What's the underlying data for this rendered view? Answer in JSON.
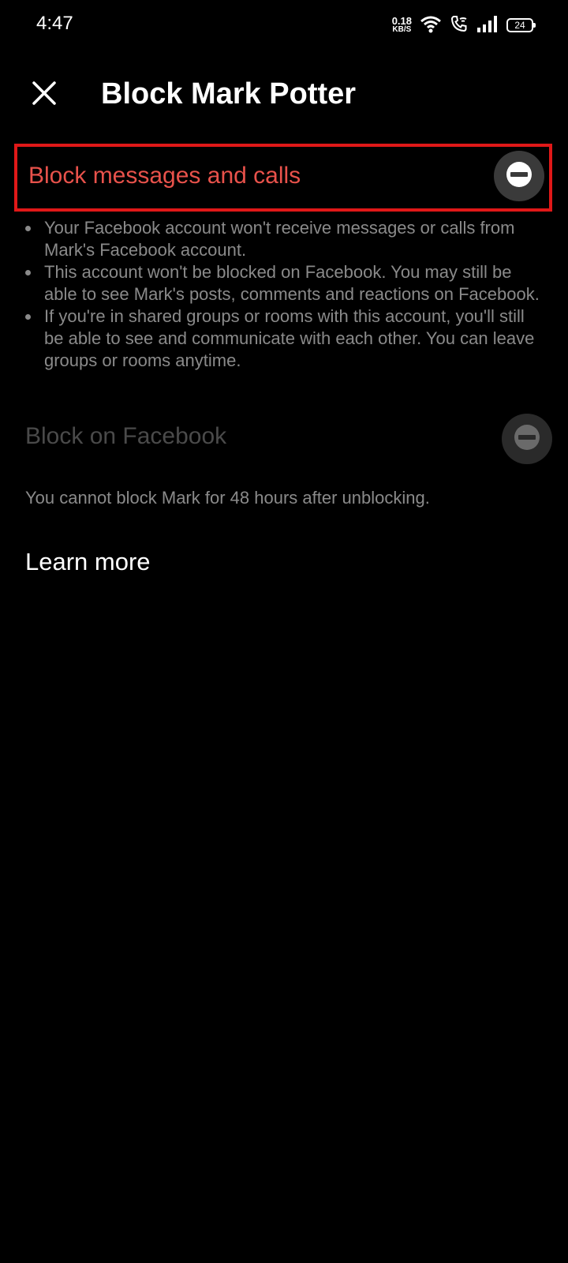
{
  "status_bar": {
    "time": "4:47",
    "net_speed_value": "0.18",
    "net_speed_unit": "KB/S",
    "battery_level": "24",
    "icons": [
      "wifi-icon",
      "wifi-call-icon",
      "signal-icon",
      "battery-icon"
    ]
  },
  "header": {
    "close_icon": "close-icon",
    "title": "Block Mark Potter"
  },
  "block_messages": {
    "label": "Block messages and calls",
    "toggle_icon": "minus-circle-icon",
    "label_color": "#e8524b",
    "highlight_color": "#e01818"
  },
  "details": [
    "Your Facebook account won't receive messages or calls from Mark's Facebook account.",
    "This account won't be blocked on Facebook. You may still be able to see Mark's posts, comments and reactions on Facebook.",
    "If you're in shared groups or rooms with this account, you'll still be able to see and communicate with each other. You can leave groups or rooms anytime."
  ],
  "block_facebook": {
    "label": "Block on Facebook",
    "toggle_icon": "minus-circle-icon",
    "note": "You cannot block Mark for 48 hours after unblocking."
  },
  "learn_more": "Learn more"
}
